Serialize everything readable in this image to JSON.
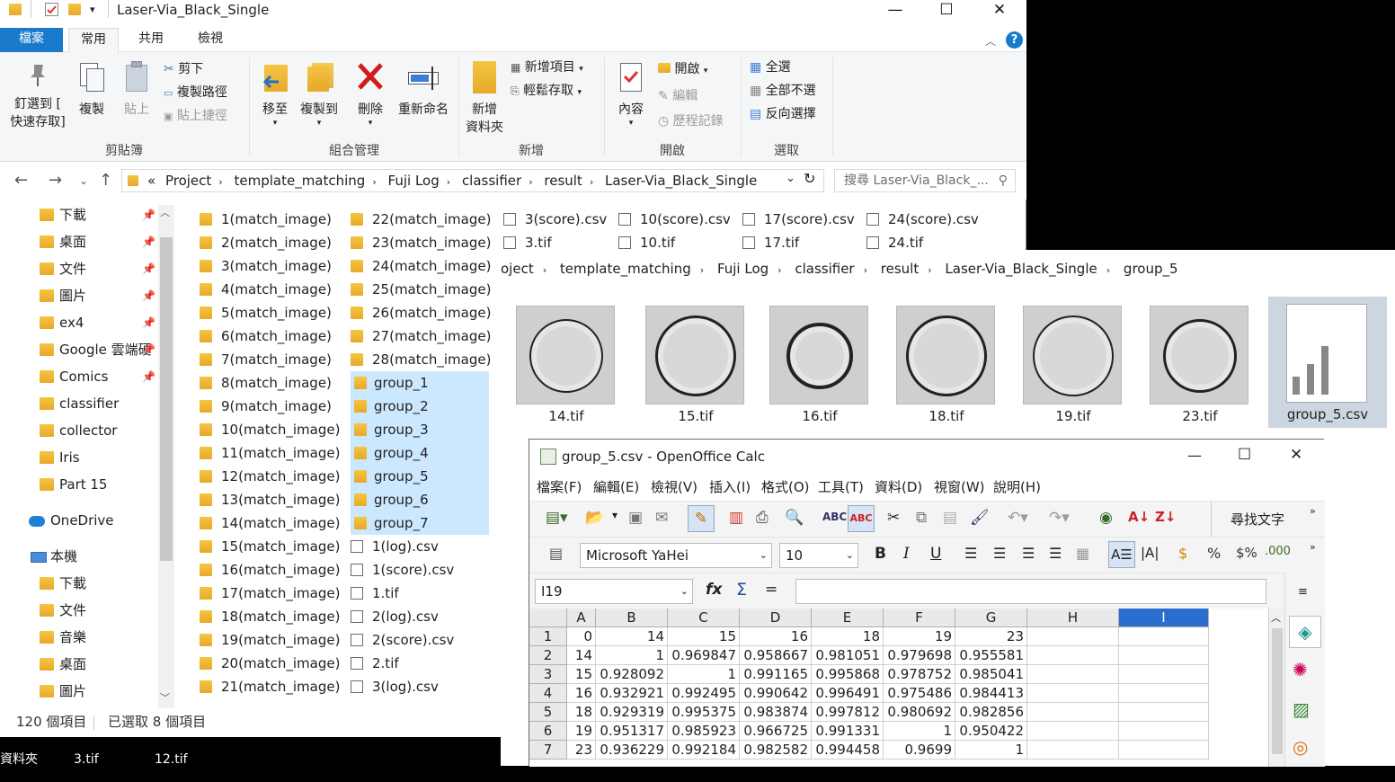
{
  "explorer": {
    "title": "Laser-Via_Black_Single",
    "window_controls": {
      "minimize": "—",
      "maximize": "☐",
      "close": "✕"
    },
    "tabs": [
      "檔案",
      "常用",
      "共用",
      "檢視"
    ],
    "help": "?",
    "ribbon": {
      "clipboard": {
        "group": "剪貼簿",
        "pin": "釘選到 [",
        "pin2": "快速存取]",
        "copy": "複製",
        "paste": "貼上",
        "cut": "剪下",
        "copy_path": "複製路徑",
        "paste_shortcut": "貼上捷徑"
      },
      "organize": {
        "group": "組合管理",
        "move_to": "移至",
        "copy_to": "複製到",
        "delete": "刪除",
        "rename": "重新命名"
      },
      "new": {
        "group": "新增",
        "new_folder": "新增",
        "new_folder2": "資料夾",
        "new_item": "新增項目",
        "easy_access": "輕鬆存取"
      },
      "open": {
        "group": "開啟",
        "properties": "內容",
        "open": "開啟",
        "edit": "編輯",
        "history": "歷程記錄"
      },
      "select": {
        "group": "選取",
        "select_all": "全選",
        "select_none": "全部不選",
        "invert": "反向選擇"
      }
    },
    "breadcrumb": [
      "«",
      "Project",
      "template_matching",
      "Fuji Log",
      "classifier",
      "result",
      "Laser-Via_Black_Single"
    ],
    "search_placeholder": "搜尋 Laser-Via_Black_...",
    "nav_items": [
      {
        "label": "下載",
        "pinned": true
      },
      {
        "label": "桌面",
        "pinned": true
      },
      {
        "label": "文件",
        "pinned": true
      },
      {
        "label": "圖片",
        "pinned": true
      },
      {
        "label": "ex4",
        "pinned": true
      },
      {
        "label": "Google 雲端硬",
        "pinned": true
      },
      {
        "label": "Comics",
        "pinned": true
      },
      {
        "label": "classifier",
        "pinned": false
      },
      {
        "label": "collector",
        "pinned": false
      },
      {
        "label": "Iris",
        "pinned": false
      },
      {
        "label": "Part 15",
        "pinned": false
      }
    ],
    "onedrive": "OneDrive",
    "this_pc": "本機",
    "pc_items": [
      "下載",
      "文件",
      "音樂",
      "桌面",
      "圖片"
    ],
    "col1": [
      "1(match_image)",
      "2(match_image)",
      "3(match_image)",
      "4(match_image)",
      "5(match_image)",
      "6(match_image)",
      "7(match_image)",
      "8(match_image)",
      "9(match_image)",
      "10(match_image)",
      "11(match_image)",
      "12(match_image)",
      "13(match_image)",
      "14(match_image)",
      "15(match_image)",
      "16(match_image)",
      "17(match_image)",
      "18(match_image)",
      "19(match_image)",
      "20(match_image)",
      "21(match_image)"
    ],
    "col2": [
      "22(match_image)",
      "23(match_image)",
      "24(match_image)",
      "25(match_image)",
      "26(match_image)",
      "27(match_image)",
      "28(match_image)",
      "group_1",
      "group_2",
      "group_3",
      "group_4",
      "group_5",
      "group_6",
      "group_7",
      "1(log).csv",
      "1(score).csv",
      "1.tif",
      "2(log).csv",
      "2(score).csv",
      "2.tif",
      "3(log).csv"
    ],
    "top_row": [
      "3(score).csv",
      "10(score).csv",
      "17(score).csv",
      "24(score).csv"
    ],
    "top_row2": [
      "3.tif",
      "10.tif",
      "17.tif",
      "24.tif"
    ],
    "status_count": "120 個項目",
    "status_selected": "已選取 8 個項目"
  },
  "explorer2": {
    "breadcrumb": [
      "oject",
      "template_matching",
      "Fuji Log",
      "classifier",
      "result",
      "Laser-Via_Black_Single",
      "group_5"
    ],
    "thumbs": [
      "14.tif",
      "15.tif",
      "16.tif",
      "18.tif",
      "19.tif",
      "23.tif",
      "group_5.csv"
    ]
  },
  "taskbar": [
    "資料夾",
    "3.tif",
    "12.tif"
  ],
  "calc": {
    "title": "group_5.csv - OpenOffice Calc",
    "menu": [
      "檔案(F)",
      "編輯(E)",
      "檢視(V)",
      "插入(I)",
      "格式(O)",
      "工具(T)",
      "資料(D)",
      "視窗(W)",
      "說明(H)"
    ],
    "find_text": "尋找文字",
    "font": "Microsoft YaHei",
    "font_size": "10",
    "cell_ref": "I19",
    "formula": "",
    "col_headers": [
      "A",
      "B",
      "C",
      "D",
      "E",
      "F",
      "G",
      "H",
      "I"
    ],
    "rows": [
      [
        "1",
        "0",
        "14",
        "15",
        "16",
        "18",
        "19",
        "23",
        "",
        ""
      ],
      [
        "2",
        "14",
        "1",
        "0.969847",
        "0.958667",
        "0.981051",
        "0.979698",
        "0.955581",
        "",
        ""
      ],
      [
        "3",
        "15",
        "0.928092",
        "1",
        "0.991165",
        "0.995868",
        "0.978752",
        "0.985041",
        "",
        ""
      ],
      [
        "4",
        "16",
        "0.932921",
        "0.992495",
        "0.990642",
        "0.996491",
        "0.975486",
        "0.984413",
        "",
        ""
      ],
      [
        "5",
        "18",
        "0.929319",
        "0.995375",
        "0.983874",
        "0.997812",
        "0.980692",
        "0.982856",
        "",
        ""
      ],
      [
        "6",
        "19",
        "0.951317",
        "0.985923",
        "0.966725",
        "0.991331",
        "1",
        "0.950422",
        "",
        ""
      ],
      [
        "7",
        "23",
        "0.936229",
        "0.992184",
        "0.982582",
        "0.994458",
        "0.9699",
        "1",
        "",
        ""
      ]
    ]
  }
}
